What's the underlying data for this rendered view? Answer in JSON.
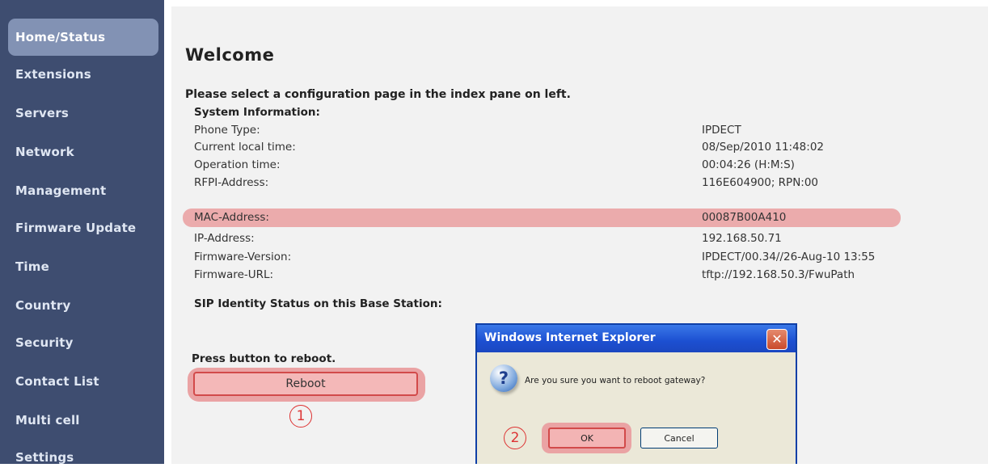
{
  "sidebar": {
    "items": [
      {
        "label": "Home/Status"
      },
      {
        "label": "Extensions"
      },
      {
        "label": "Servers"
      },
      {
        "label": "Network"
      },
      {
        "label": "Management"
      },
      {
        "label": "Firmware Update"
      },
      {
        "label": "Time"
      },
      {
        "label": "Country"
      },
      {
        "label": "Security"
      },
      {
        "label": "Contact List"
      },
      {
        "label": "Multi cell"
      },
      {
        "label": "Settings"
      }
    ],
    "active": "Home/Status"
  },
  "main": {
    "title": "Welcome",
    "intro": "Please select a configuration page in the index pane on left.",
    "system_heading": "System Information:",
    "rows": [
      {
        "label": "Phone Type:",
        "value": "IPDECT"
      },
      {
        "label": "Current local time:",
        "value": "08/Sep/2010 11:48:02"
      },
      {
        "label": "Operation time:",
        "value": "00:04:26 (H:M:S)"
      },
      {
        "label": "RFPI-Address:",
        "value": "116E604900; RPN:00"
      },
      {
        "label": "MAC-Address:",
        "value": "00087B00A410"
      },
      {
        "label": "IP-Address:",
        "value": "192.168.50.71"
      },
      {
        "label": "Firmware-Version:",
        "value": "IPDECT/00.34//26-Aug-10 13:55"
      },
      {
        "label": "Firmware-URL:",
        "value": "tftp://192.168.50.3/FwuPath"
      }
    ],
    "sip_heading": "SIP Identity Status on this Base Station:",
    "reboot_prompt": "Press button to reboot.",
    "reboot_label": "Reboot",
    "step_1": "1"
  },
  "dialog": {
    "title": "Windows Internet Explorer",
    "message": "Are you sure you want to reboot gateway?",
    "ok_label": "OK",
    "cancel_label": "Cancel",
    "close_glyph": "✕",
    "icon": "question-icon",
    "icon_glyph": "?",
    "step_2": "2"
  },
  "colors": {
    "sidebar_bg": "#3e4d70",
    "active_item_bg": "#8292b4",
    "highlight": "#eaa3a4",
    "annotation_red": "#d33333",
    "titlebar_blue": "#1c4fd1"
  }
}
